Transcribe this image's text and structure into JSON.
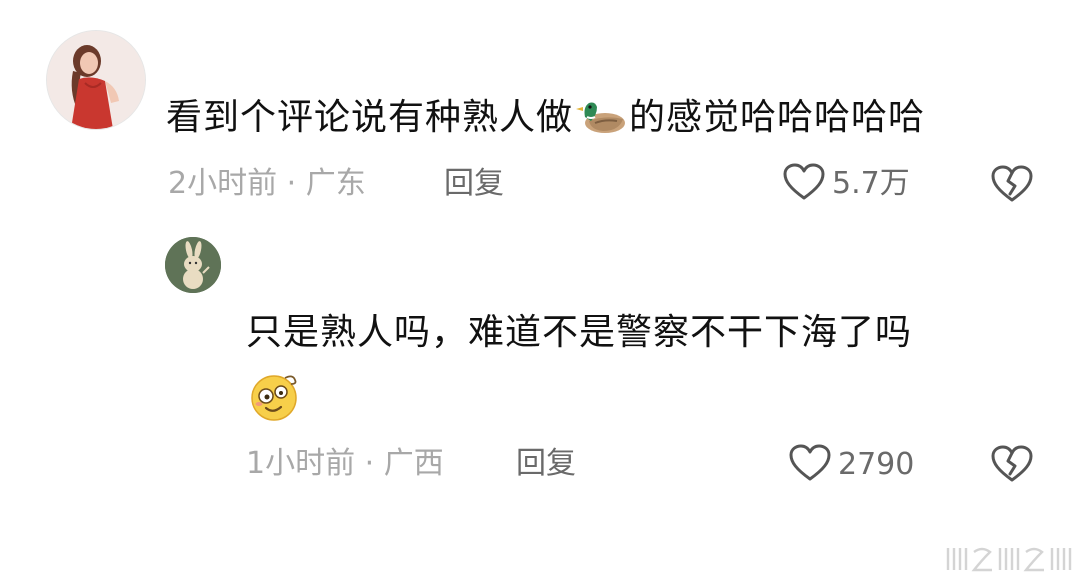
{
  "comments": [
    {
      "text_before": "看到个评论说有种熟人做",
      "inline_emoji": "duck-emoji",
      "text_after": "的感觉哈哈哈哈哈",
      "time": "2小时前",
      "separator": "·",
      "location": "广东",
      "reply_label": "回复",
      "likes": "5.7万"
    }
  ],
  "replies": [
    {
      "text": "只是熟人吗，难道不是警察不干下海了吗",
      "trailing_emoji": "dazed-face-emoji",
      "time": "1小时前",
      "separator": "·",
      "location": "广西",
      "reply_label": "回复",
      "likes": "2790"
    }
  ],
  "icons": {
    "like": "heart-outline-icon",
    "dislike": "broken-heart-icon"
  },
  "colors": {
    "meta_text": "#a8a8a8",
    "action_text": "#6a6a6a",
    "icon_stroke": "#555555"
  }
}
